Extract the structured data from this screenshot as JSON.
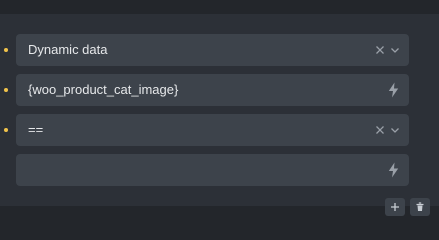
{
  "conditions": [
    {
      "value": "Dynamic data",
      "control": "select"
    },
    {
      "value": "{woo_product_cat_image}",
      "control": "dynamic"
    },
    {
      "value": "==",
      "control": "select"
    },
    {
      "value": "",
      "control": "dynamic"
    }
  ],
  "colors": {
    "background": "#23262b",
    "panel": "#2c3037",
    "field": "#3d434b",
    "accent_dot": "#f0c24b",
    "text": "#e6e8ea",
    "icon": "#9aa0a8"
  },
  "icons": {
    "clear": "close-icon",
    "dropdown": "chevron-down-icon",
    "dynamic": "lightning-bolt-icon",
    "add": "plus-icon",
    "delete": "trash-icon"
  }
}
